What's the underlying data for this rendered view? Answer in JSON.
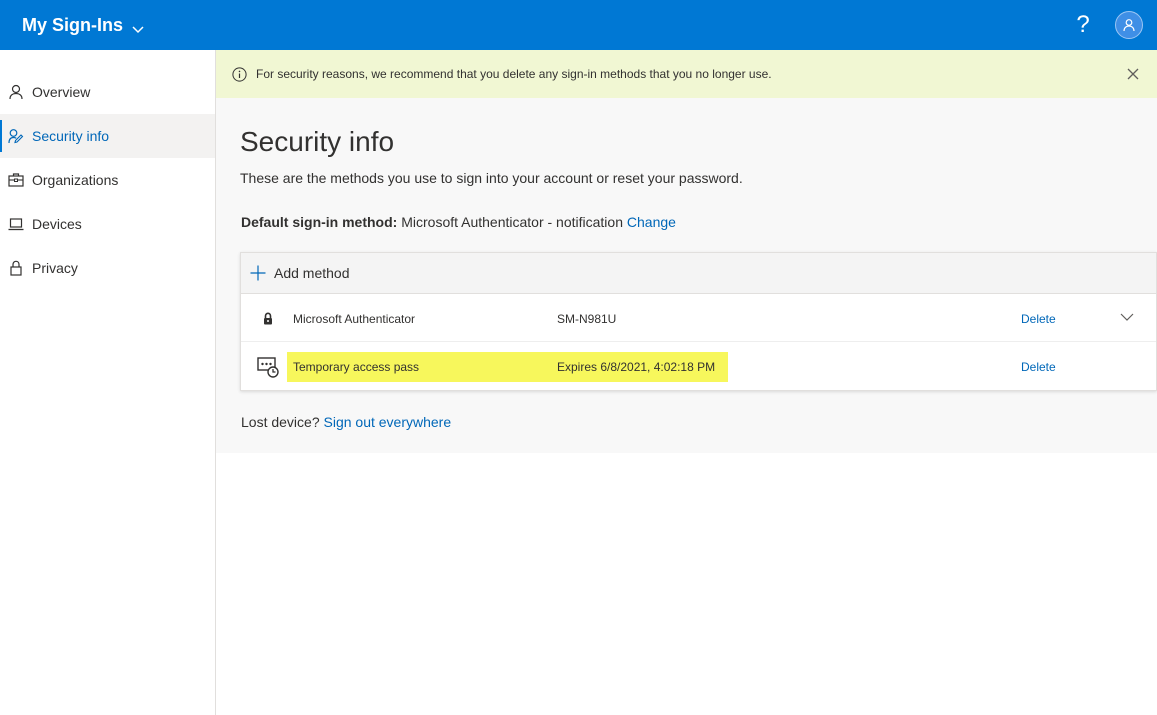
{
  "header": {
    "app_title": "My Sign-Ins",
    "help_label": "?"
  },
  "sidebar": {
    "items": [
      {
        "label": "Overview",
        "icon": "person-icon"
      },
      {
        "label": "Security info",
        "icon": "security-key-icon",
        "active": true
      },
      {
        "label": "Organizations",
        "icon": "briefcase-icon"
      },
      {
        "label": "Devices",
        "icon": "laptop-icon"
      },
      {
        "label": "Privacy",
        "icon": "lock-icon"
      }
    ]
  },
  "banner": {
    "text": "For security reasons, we recommend that you delete any sign-in methods that you no longer use."
  },
  "main": {
    "title": "Security info",
    "subtitle": "These are the methods you use to sign into your account or reset your password.",
    "default_label": "Default sign-in method:",
    "default_value": " Microsoft Authenticator - notification ",
    "change_link": "Change",
    "add_method": "Add method",
    "methods": [
      {
        "name": "Microsoft Authenticator",
        "detail": "SM-N981U",
        "delete": "Delete",
        "icon": "authenticator-lock-icon"
      },
      {
        "name": "Temporary access pass",
        "detail": "Expires 6/8/2021, 4:02:18 PM",
        "delete": "Delete",
        "icon": "temporary-pass-icon"
      }
    ],
    "lost_device_text": "Lost device? ",
    "sign_out_link": "Sign out everywhere"
  },
  "colors": {
    "header_bg": "#0078d4",
    "link": "#0067b8",
    "banner_bg": "#f1f7d3",
    "highlight": "#f7f75c"
  }
}
